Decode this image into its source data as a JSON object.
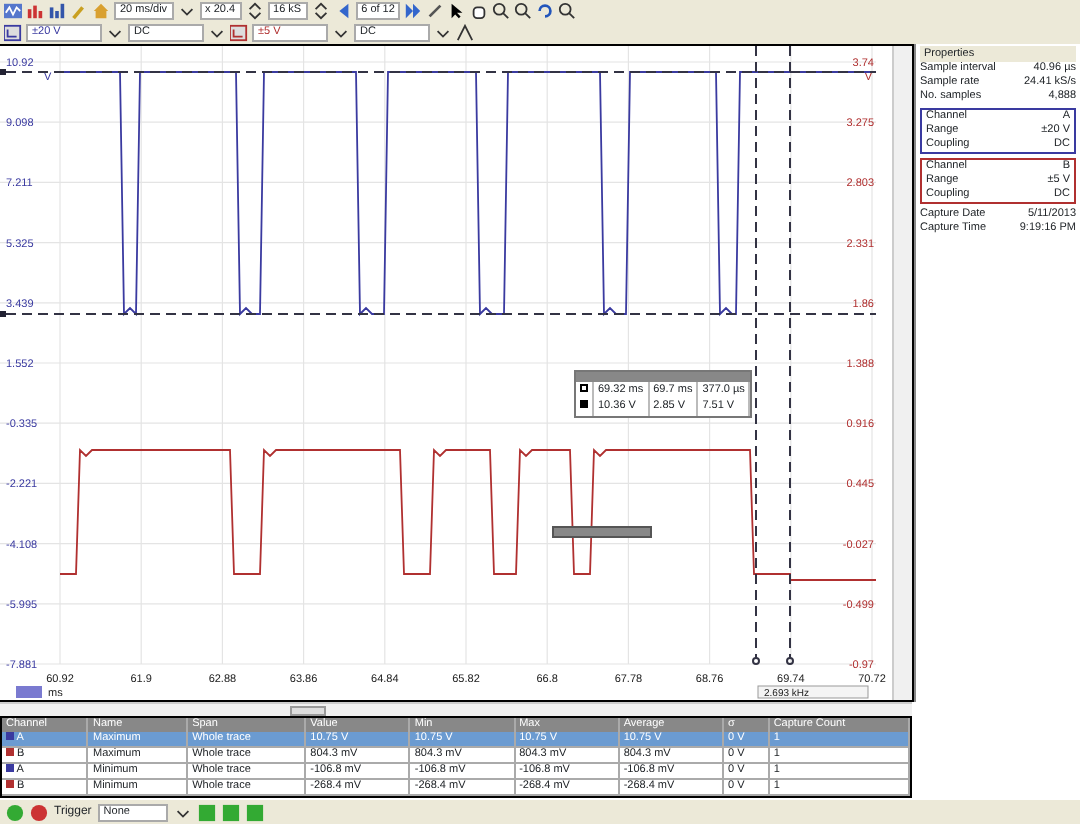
{
  "toolbar": {
    "timebase": "20 ms/div",
    "zoom": "x 20.4",
    "samples": "16 kS",
    "capture": "6 of 12"
  },
  "channel_bar": [
    {
      "range": "±20 V",
      "coupling": "DC",
      "color": "#3a3aa0"
    },
    {
      "range": "±5 V",
      "coupling": "DC",
      "color": "#b03030"
    }
  ],
  "plot": {
    "left_unit": "V",
    "right_unit": "V",
    "left_ticks": [
      "10.92",
      "9.098",
      "7.211",
      "5.325",
      "3.439",
      "1.552",
      "-0.335",
      "-2.221",
      "-4.108",
      "-5.995",
      "-7.881"
    ],
    "right_ticks": [
      "3.74",
      "3.275",
      "2.803",
      "2.331",
      "1.86",
      "1.388",
      "0.916",
      "0.445",
      "-0.027",
      "-0.499",
      "-0.97"
    ],
    "x_ticks": [
      "60.92",
      "61.9",
      "62.88",
      "63.86",
      "64.84",
      "65.82",
      "66.8",
      "67.78",
      "68.76",
      "69.74",
      "70.72"
    ],
    "x_unit": "ms",
    "frequency": "2.693 kHz"
  },
  "ruler_table": [
    [
      "69.32 ms",
      "69.7 ms",
      "377.0 µs"
    ],
    [
      "10.36 V",
      "2.85 V",
      "7.51 V"
    ]
  ],
  "properties": {
    "title": "Properties",
    "rows": [
      {
        "label": "Sample interval",
        "value": "40.96 µs"
      },
      {
        "label": "Sample rate",
        "value": "24.41 kS/s"
      },
      {
        "label": "No. samples",
        "value": "4,888"
      }
    ],
    "channels": [
      {
        "color": "#3a3aa0",
        "rows": [
          {
            "label": "Channel",
            "value": "A"
          },
          {
            "label": "Range",
            "value": "±20 V"
          },
          {
            "label": "Coupling",
            "value": "DC"
          }
        ]
      },
      {
        "color": "#b03030",
        "rows": [
          {
            "label": "Channel",
            "value": "B"
          },
          {
            "label": "Range",
            "value": "±5 V"
          },
          {
            "label": "Coupling",
            "value": "DC"
          }
        ]
      }
    ],
    "capture": [
      {
        "label": "Capture Date",
        "value": "5/11/2013"
      },
      {
        "label": "Capture Time",
        "value": "9:19:16 PM"
      }
    ]
  },
  "measurements": {
    "columns": [
      "Channel",
      "Name",
      "Span",
      "Value",
      "Min",
      "Max",
      "Average",
      "σ",
      "Capture Count"
    ],
    "rows": [
      {
        "color": "#3a3aa0",
        "selected": true,
        "cells": [
          "A",
          "Maximum",
          "Whole trace",
          "10.75 V",
          "10.75 V",
          "10.75 V",
          "10.75 V",
          "0 V",
          "1"
        ]
      },
      {
        "color": "#b03030",
        "selected": false,
        "cells": [
          "B",
          "Maximum",
          "Whole trace",
          "804.3 mV",
          "804.3 mV",
          "804.3 mV",
          "804.3 mV",
          "0 V",
          "1"
        ]
      },
      {
        "color": "#3a3aa0",
        "selected": false,
        "cells": [
          "A",
          "Minimum",
          "Whole trace",
          "-106.8 mV",
          "-106.8 mV",
          "-106.8 mV",
          "-106.8 mV",
          "0 V",
          "1"
        ]
      },
      {
        "color": "#b03030",
        "selected": false,
        "cells": [
          "B",
          "Minimum",
          "Whole trace",
          "-268.4 mV",
          "-268.4 mV",
          "-268.4 mV",
          "-268.4 mV",
          "0 V",
          "1"
        ]
      }
    ]
  },
  "trigger": {
    "label": "Trigger",
    "mode": "None"
  }
}
